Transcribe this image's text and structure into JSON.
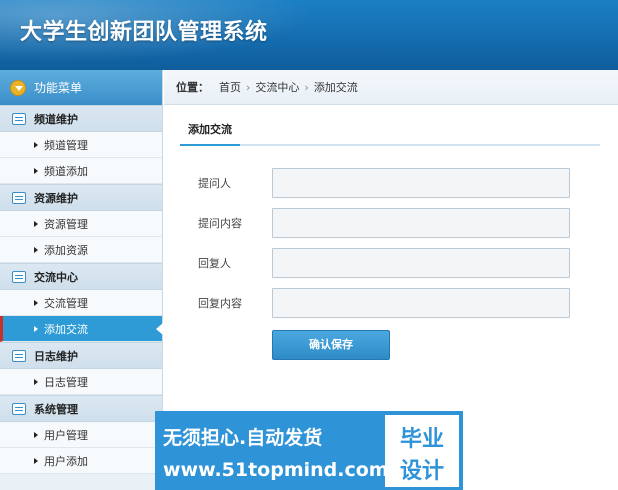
{
  "header": {
    "title": "大学生创新团队管理系统"
  },
  "sidebar": {
    "menu_title": "功能菜单",
    "groups": [
      {
        "label": "频道维护",
        "items": [
          {
            "label": "频道管理"
          },
          {
            "label": "频道添加"
          }
        ]
      },
      {
        "label": "资源维护",
        "items": [
          {
            "label": "资源管理"
          },
          {
            "label": "添加资源"
          }
        ]
      },
      {
        "label": "交流中心",
        "items": [
          {
            "label": "交流管理"
          },
          {
            "label": "添加交流",
            "active": true
          }
        ]
      },
      {
        "label": "日志维护",
        "items": [
          {
            "label": "日志管理"
          }
        ]
      },
      {
        "label": "系统管理",
        "items": [
          {
            "label": "用户管理"
          },
          {
            "label": "用户添加"
          }
        ]
      }
    ]
  },
  "breadcrumb": {
    "label": "位置：",
    "items": [
      "首页",
      "交流中心",
      "添加交流"
    ]
  },
  "main": {
    "tab": "添加交流",
    "fields": [
      {
        "label": "提问人",
        "value": ""
      },
      {
        "label": "提问内容",
        "value": ""
      },
      {
        "label": "回复人",
        "value": ""
      },
      {
        "label": "回复内容",
        "value": ""
      }
    ],
    "submit_label": "确认保存"
  },
  "watermark": {
    "line1": "无须担心.自动发货",
    "line2": "www.51topmind.com",
    "badge_top": "毕业",
    "badge_bottom": "设计"
  },
  "colors": {
    "header": "#1670b3",
    "accent": "#2e9bd6",
    "active_marker": "#c9302c"
  }
}
